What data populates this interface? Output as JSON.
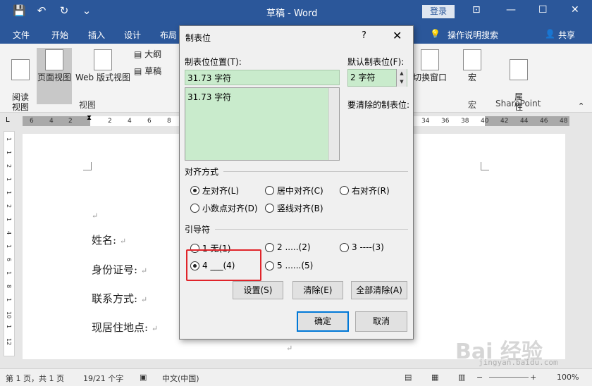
{
  "titlebar": {
    "doc_title": "草稿 - Word",
    "login": "登录"
  },
  "tabs": [
    "文件",
    "开始",
    "插入",
    "设计",
    "布局"
  ],
  "tell_me": "操作说明搜索",
  "share": "共享",
  "ribbon": {
    "read_mode": "阅读\n视图",
    "page_view": "页面视图",
    "web_view": "Web 版式视图",
    "outline": "大纲",
    "draft": "草稿",
    "group_view": "视图",
    "switch_window": "切换窗口",
    "macro": "宏",
    "macro_group": "宏",
    "properties": "属\n性",
    "sharepoint": "SharePoint"
  },
  "ruler_left": [
    "6",
    "4",
    "2",
    "2",
    "4",
    "6",
    "8"
  ],
  "ruler_right": [
    "34",
    "36",
    "38",
    "40",
    "42",
    "44",
    "46",
    "48"
  ],
  "document": {
    "lines": [
      "姓名:",
      "身份证号:",
      "联系方式:",
      "现居住地点:"
    ]
  },
  "dialog": {
    "title": "制表位",
    "help": "?",
    "close": "✕",
    "tab_pos_label": "制表位位置(T):",
    "tab_pos_value": "31.73 字符",
    "tab_list": [
      "31.73 字符"
    ],
    "default_label": "默认制表位(F):",
    "default_value": "2 字符",
    "clear_label": "要清除的制表位:",
    "align_label": "对齐方式",
    "align_options": [
      "左对齐(L)",
      "居中对齐(C)",
      "右对齐(R)",
      "小数点对齐(D)",
      "竖线对齐(B)"
    ],
    "align_selected": "左对齐(L)",
    "leader_label": "引导符",
    "leader_options": [
      "1 无(1)",
      "2 .....(2)",
      "3 ----(3)",
      "4 ___(4)",
      "5 ......(5)"
    ],
    "leader_selected": "4 ___(4)",
    "btn_set": "设置(S)",
    "btn_clear": "清除(E)",
    "btn_clear_all": "全部清除(A)",
    "btn_ok": "确定",
    "btn_cancel": "取消"
  },
  "status": {
    "page": "第 1 页，共 1 页",
    "words": "19/21 个字",
    "lang": "中文(中国)",
    "zoom": "100%"
  },
  "watermark": "Bai 经验",
  "watermark_url": "jingyan.baidu.com",
  "colors": {
    "accent": "#2b579a",
    "field_bg": "#c9ebcc",
    "highlight": "#e0242a"
  }
}
